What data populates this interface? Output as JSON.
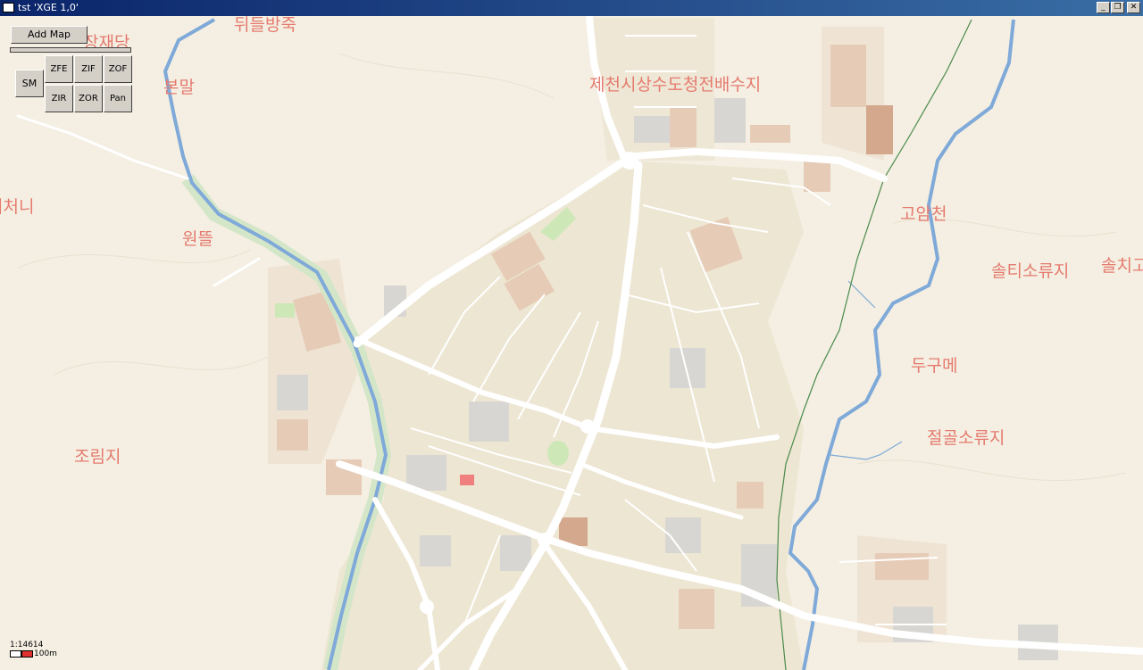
{
  "window": {
    "title": "tst 'XGE 1,0'",
    "buttons": {
      "minimize": "_",
      "restore": "❐",
      "close": "✕"
    }
  },
  "toolbar": {
    "add_map": "Add Map",
    "sm": "SM",
    "zfe": "ZFE",
    "zif": "ZIF",
    "zof": "ZOF",
    "zir": "ZIR",
    "zor": "ZOR",
    "pan": "Pan"
  },
  "map": {
    "place_labels": [
      "뒤들방죽",
      "장재당",
      "본말",
      "제천시상수도청전배수지",
      "거처니",
      "원뜰",
      "고암천",
      "솔티소류지",
      "솔치고",
      "두구메",
      "절골소류지",
      "조림지"
    ],
    "colors": {
      "background": "#f4efe2",
      "road": "#ffffff",
      "river": "#7fa9d8",
      "building": "#d8cdb8",
      "residential": "#ebd9c6",
      "park": "#cde8b6",
      "label": "#e57a6e"
    }
  },
  "scale": {
    "ratio": "1:14614",
    "distance": "100m"
  }
}
